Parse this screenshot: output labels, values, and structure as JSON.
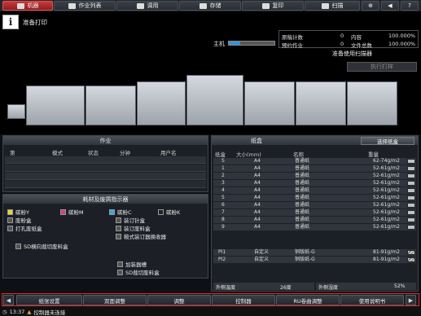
{
  "tabs": [
    {
      "label": "机器",
      "icon": "machine-icon",
      "active": true
    },
    {
      "label": "作业列表",
      "icon": "job-list-icon",
      "active": false
    },
    {
      "label": "调用",
      "icon": "recall-icon",
      "active": false
    },
    {
      "label": "存储",
      "icon": "store-icon",
      "active": false
    },
    {
      "label": "复印",
      "icon": "copy-icon",
      "active": false
    },
    {
      "label": "扫描",
      "icon": "scan-icon",
      "active": false
    }
  ],
  "status": {
    "message": "准备打印",
    "host_label": "主机",
    "counters": {
      "originals_label": "原稿计数",
      "originals_value": "0",
      "memory_label": "内容",
      "memory_value": "100.000%",
      "reserved_label": "预约作业",
      "reserved_value": "0",
      "total_label": "文件总数",
      "total_value": "100.000%"
    },
    "scanner_msg": "准备使用扫描器",
    "exec_button": "执行打样"
  },
  "job_panel": {
    "title": "作业",
    "headers": [
      "第",
      "模式",
      "状态",
      "分钟",
      "用户名"
    ]
  },
  "consumables": {
    "title": "耗材及废屑指示器",
    "items": [
      {
        "label": "碳粉Y",
        "color": "#e8d23a"
      },
      {
        "label": "碳粉M",
        "color": "#d63b8c"
      },
      {
        "label": "碳粉C",
        "color": "#3aa8e0"
      },
      {
        "label": "碳粉K",
        "color": "#222222"
      },
      {
        "label": "废粉盒"
      },
      {
        "label": "装订针盒"
      },
      {
        "label": "打孔废纸盒"
      },
      {
        "label": "装订废料盒"
      },
      {
        "label": "鞍式装订器换收器"
      },
      {
        "label": "SD横向裁切废料盒"
      },
      {
        "label": "加装器槽"
      },
      {
        "label": "SD裁切废料盒"
      }
    ]
  },
  "tray_panel": {
    "title": "纸盒",
    "select_button": "选择纸盒",
    "headers": [
      "纸盒",
      "大小(mm)",
      "名称",
      "重量"
    ],
    "rows": [
      {
        "tray": "S",
        "size": "A4",
        "name": "普通纸",
        "weight": "62-74g/m2"
      },
      {
        "tray": "1",
        "size": "A4",
        "name": "普通纸",
        "weight": "52-61g/m2"
      },
      {
        "tray": "2",
        "size": "A4",
        "name": "普通纸",
        "weight": "52-61g/m2"
      },
      {
        "tray": "3",
        "size": "A4",
        "name": "普通纸",
        "weight": "52-61g/m2"
      },
      {
        "tray": "4",
        "size": "A4",
        "name": "普通纸",
        "weight": "52-61g/m2"
      },
      {
        "tray": "5",
        "size": "A4",
        "name": "普通纸",
        "weight": "52-61g/m2"
      },
      {
        "tray": "6",
        "size": "A4",
        "name": "普通纸",
        "weight": "52-61g/m2"
      },
      {
        "tray": "7",
        "size": "A4",
        "name": "普通纸",
        "weight": "52-61g/m2"
      },
      {
        "tray": "8",
        "size": "A4",
        "name": "普通纸",
        "weight": "52-61g/m2"
      },
      {
        "tray": "9",
        "size": "A4",
        "name": "普通纸",
        "weight": "52-61g/m2"
      },
      {
        "tray": "PI1",
        "size": "自定义",
        "name": "铜版纸-G",
        "weight": "81-91g/m2"
      },
      {
        "tray": "PI2",
        "size": "自定义",
        "name": "铜版纸-G",
        "weight": "81-91g/m2"
      }
    ],
    "ext_temp_label": "外侧温度",
    "ext_temp_value": "26度",
    "ext_humid_label": "外侧湿度",
    "ext_humid_value": "52%"
  },
  "bottom_buttons": [
    "纸张设置",
    "双面调整",
    "调整",
    "控制器",
    "RU卷曲调整",
    "使用说明书"
  ],
  "footer": {
    "time": "13:37",
    "message": "控制器未连接"
  }
}
